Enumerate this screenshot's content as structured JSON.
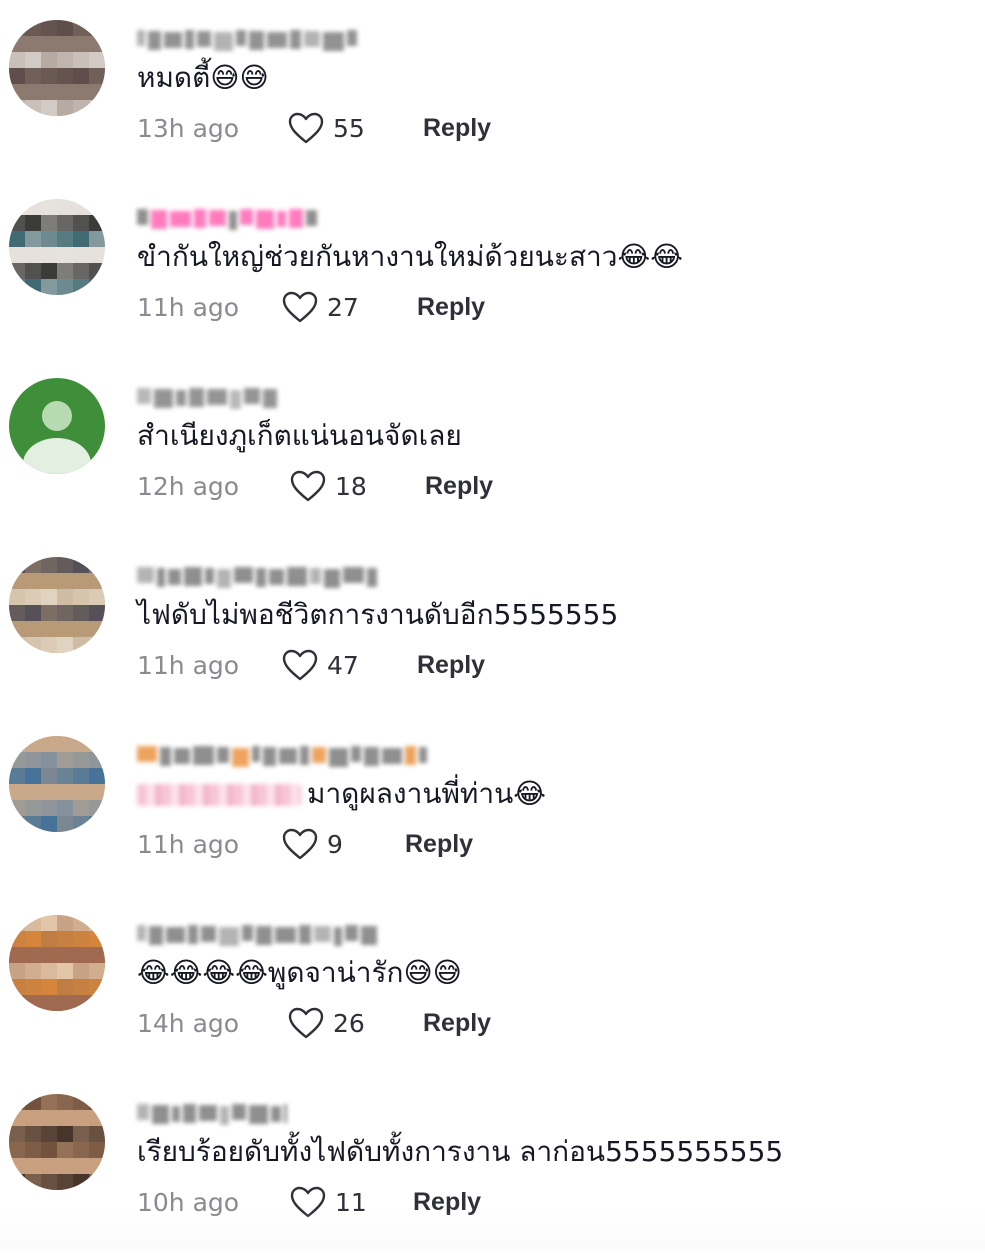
{
  "comments": [
    {
      "text": "หมดตี้😅😅",
      "time": "13h ago",
      "likes": "55",
      "reply_label": "Reply",
      "avatar_colors": [
        "#5a4a45",
        "#8c7a70",
        "#d8d2cc"
      ],
      "username_colors": [
        "#6e6e6e",
        "#9a9a9a"
      ]
    },
    {
      "text": "ขำกันใหญ่ช่วยกันหางานใหม่ด้วยนะสาว😂😂",
      "time": "11h ago",
      "likes": "27",
      "reply_label": "Reply",
      "avatar_colors": [
        "#2f5f6a",
        "#e6e1dc",
        "#2a2a2a"
      ],
      "username_colors": [
        "#ff4fa8",
        "#6a6a6a"
      ]
    },
    {
      "text": "สำเนียงภูเก็ตแน่นอนจัดเลย",
      "time": "12h ago",
      "likes": "18",
      "reply_label": "Reply",
      "avatar_colors": [
        "#3f8f3a",
        "#7fbf77",
        "#d9ead6"
      ],
      "username_colors": [
        "#707070",
        "#a0a0a0"
      ]
    },
    {
      "text": "ไฟดับไม่พอชีวิตการงานดับอีก5555555",
      "time": "11h ago",
      "likes": "47",
      "reply_label": "Reply",
      "avatar_colors": [
        "#4c4a55",
        "#b89a78",
        "#e4d8c8"
      ],
      "username_colors": [
        "#6a6a6a",
        "#9b9b9b"
      ]
    },
    {
      "text": "มาดูผลงานพี่ท่าน😂",
      "time": "11h ago",
      "likes": "9",
      "reply_label": "Reply",
      "has_mention": true,
      "avatar_colors": [
        "#3a6e9a",
        "#c9a98a",
        "#7f8f9f"
      ],
      "username_colors": [
        "#6a6a6a",
        "#e8852a"
      ]
    },
    {
      "text": "😂😂😂😂พูดจาน่ารัก😅😅",
      "time": "14h ago",
      "likes": "26",
      "reply_label": "Reply",
      "avatar_colors": [
        "#d88a3a",
        "#a06a50",
        "#e8d0b0"
      ],
      "username_colors": [
        "#6a6a6a",
        "#9b9b9b"
      ]
    },
    {
      "text": "เรียบร้อยดับทั้งไฟดับทั้งการงาน ลาก่อน5555555555",
      "time": "10h ago",
      "likes": "11",
      "reply_label": "Reply",
      "avatar_colors": [
        "#6a4a35",
        "#c8a080",
        "#3a2a22"
      ],
      "username_colors": [
        "#6a6a6a",
        "#9b9b9b"
      ]
    }
  ]
}
